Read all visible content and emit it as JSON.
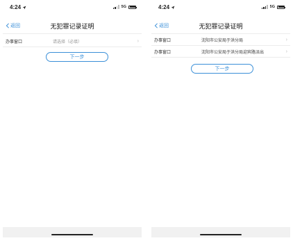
{
  "screens": [
    {
      "status": {
        "time": "4:24",
        "network": "5G"
      },
      "nav": {
        "back_label": "返回",
        "title": "无犯罪记录证明"
      },
      "rows": [
        {
          "label": "办事窗口",
          "value": "请选择（必填）"
        }
      ],
      "next_label": "下一步"
    },
    {
      "status": {
        "time": "4:24",
        "network": "5G"
      },
      "nav": {
        "back_label": "返回",
        "title": "无犯罪记录证明"
      },
      "rows": [
        {
          "label": "办事窗口",
          "value": "沈阳市公安局于洪分局"
        },
        {
          "label": "办事窗口",
          "value": "沈阳市公安局于洪分局迎宾路派出"
        }
      ],
      "next_label": "下一步"
    }
  ],
  "colors": {
    "accent": "#3a8fd8",
    "placeholder": "#999999",
    "divider": "#ececec"
  }
}
